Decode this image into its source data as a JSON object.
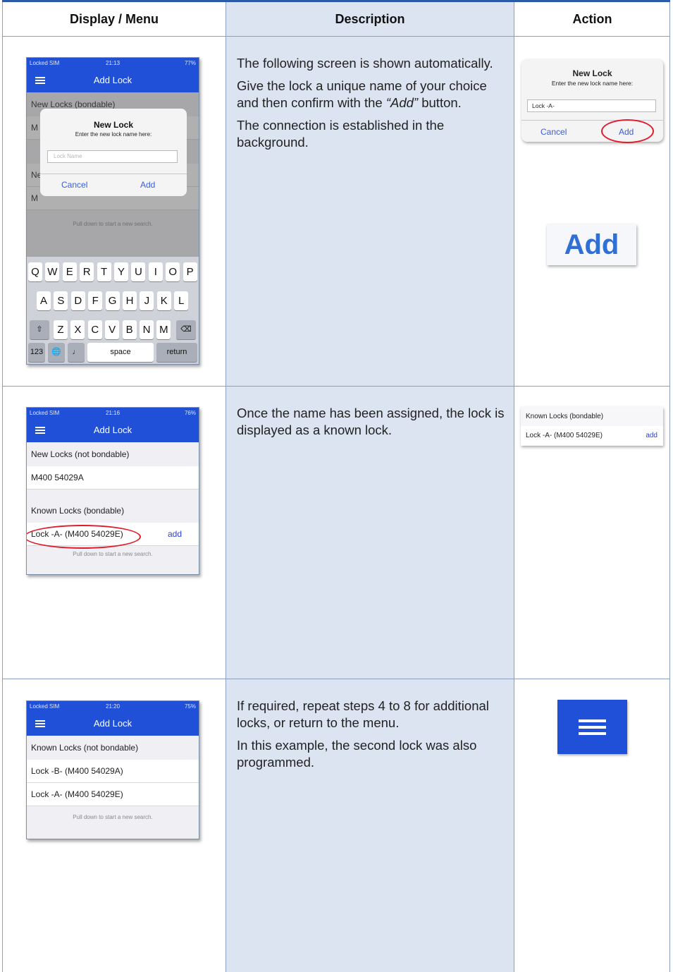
{
  "table": {
    "headers": [
      "Display / Menu",
      "Description",
      "Action"
    ]
  },
  "rows": [
    {
      "description": [
        "The following screen is shown automatically.",
        "Give the lock a unique name of your choice and then confirm with the",
        "“Add”",
        "button.",
        "The connection is established in the background."
      ]
    },
    {
      "description": [
        "Once the name has been assigned, the lock is displayed as a known lock."
      ]
    },
    {
      "description": [
        "If required, repeat steps 4 to 8 for additional locks, or return to the menu.",
        "In this example, the second lock was also programmed."
      ]
    }
  ],
  "phone1": {
    "status_left": "Locked SIM",
    "status_time": "21:13",
    "status_right": "77%",
    "title": "Add Lock",
    "bg_section": "New Locks (bondable)",
    "bg_rows": [
      "M",
      "Ne",
      "M"
    ],
    "hint": "Pull down to start a new search.",
    "dialog_title": "New Lock",
    "dialog_subtitle": "Enter the new lock name here:",
    "dialog_placeholder": "Lock Name",
    "dialog_cancel": "Cancel",
    "dialog_add": "Add",
    "keyboard_row1": [
      "Q",
      "W",
      "E",
      "R",
      "T",
      "Y",
      "U",
      "I",
      "O",
      "P"
    ],
    "keyboard_row2": [
      "A",
      "S",
      "D",
      "F",
      "G",
      "H",
      "J",
      "K",
      "L"
    ],
    "keyboard_row3": [
      "Z",
      "X",
      "C",
      "V",
      "B",
      "N",
      "M"
    ],
    "key_123": "123",
    "key_space": "space",
    "key_return": "return"
  },
  "phone2": {
    "status_left": "Locked SIM",
    "status_time": "21:16",
    "status_right": "76%",
    "title": "Add Lock",
    "section1": "New Locks (not bondable)",
    "row1": "M400 54029A",
    "section2": "Known Locks (bondable)",
    "row2": "Lock -A- (M400 54029E)",
    "row2_action": "add",
    "hint": "Pull down to start a new search."
  },
  "phone3": {
    "status_left": "Locked SIM",
    "status_time": "21:20",
    "status_right": "75%",
    "title": "Add Lock",
    "section1": "Known Locks (not bondable)",
    "row1": "Lock -B- (M400 54029A)",
    "row2": "Lock -A- (M400 54029E)",
    "hint": "Pull down to start a new search."
  },
  "action1": {
    "dialog_title": "New Lock",
    "dialog_subtitle": "Enter the new lock name here:",
    "dialog_value": "Lock -A-",
    "dialog_cancel": "Cancel",
    "dialog_add": "Add",
    "big_button": "Add"
  },
  "action2": {
    "section": "Known Locks (bondable)",
    "row": "Lock -A- (M400 54029E)",
    "row_action": "add"
  },
  "colors": {
    "header_blue": "#2150d8",
    "description_bg": "#dce4f1",
    "highlight_red": "#e01b2c",
    "link_blue": "#2b3fd4"
  }
}
